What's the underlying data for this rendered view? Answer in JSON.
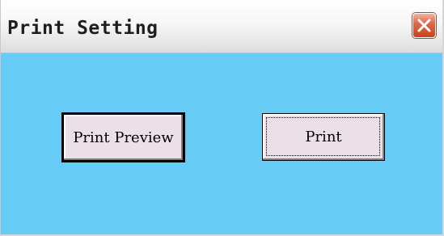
{
  "window": {
    "title": "Print Setting"
  },
  "titlebar": {
    "close_icon": "close-icon",
    "close_color": "#d9532e"
  },
  "buttons": {
    "preview_label": "Print Preview",
    "print_label": "Print"
  },
  "colors": {
    "client_background": "#66ccf6",
    "button_face": "#eae0e6"
  }
}
